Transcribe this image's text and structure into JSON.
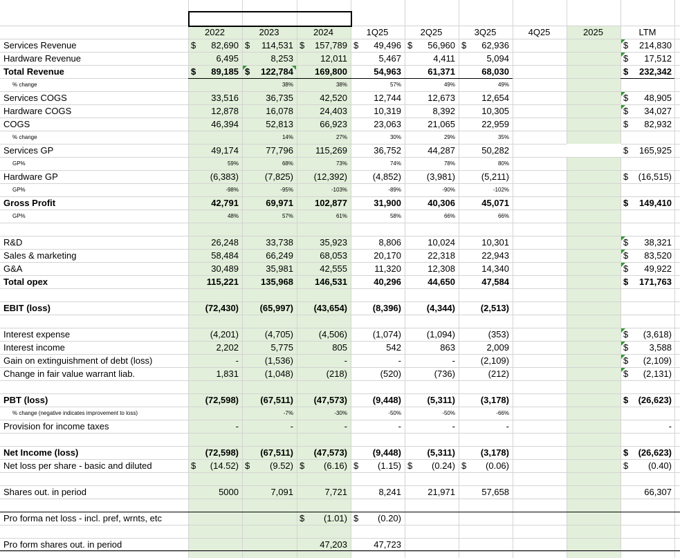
{
  "colors": {
    "green_fill": "#e2efda",
    "grid": "#d4d4d4",
    "flag": "#339933"
  },
  "columns": [
    "2022",
    "2023",
    "2024",
    "1Q25",
    "2Q25",
    "3Q25",
    "4Q25",
    "2025",
    "LTM"
  ],
  "rows": [
    {
      "label": "Services Revenue",
      "values": [
        "$ 82,690",
        "$ 114,531",
        "$ 157,789",
        "$ 49,496",
        "$ 56,960",
        "$ 62,936",
        "",
        "",
        "$ 214,830"
      ]
    },
    {
      "label": "Hardware Revenue",
      "values": [
        "6,495",
        "8,253",
        "12,011",
        "5,467",
        "4,411",
        "5,094",
        "",
        "",
        "$ 17,512"
      ]
    },
    {
      "label": "Total Revenue",
      "values": [
        "$ 89,185",
        "$ 122,784",
        "169,800",
        "54,963",
        "61,371",
        "68,030",
        "",
        "",
        "$ 232,342"
      ]
    },
    {
      "label": "% change",
      "values": [
        "",
        "38%",
        "38%",
        "57%",
        "49%",
        "49%",
        "",
        "",
        ""
      ]
    },
    {
      "label": "Services COGS",
      "values": [
        "33,516",
        "36,735",
        "42,520",
        "12,744",
        "12,673",
        "12,654",
        "",
        "",
        "$ 48,905"
      ]
    },
    {
      "label": "Hardware COGS",
      "values": [
        "12,878",
        "16,078",
        "24,403",
        "10,319",
        "8,392",
        "10,305",
        "",
        "",
        "$ 34,027"
      ]
    },
    {
      "label": "COGS",
      "values": [
        "46,394",
        "52,813",
        "66,923",
        "23,063",
        "21,065",
        "22,959",
        "",
        "",
        "$ 82,932"
      ]
    },
    {
      "label": "% change",
      "values": [
        "",
        "14%",
        "27%",
        "30%",
        "29%",
        "35%",
        "",
        "",
        ""
      ]
    },
    {
      "label": "Services GP",
      "values": [
        "49,174",
        "77,796",
        "115,269",
        "36,752",
        "44,287",
        "50,282",
        "",
        "",
        "$ 165,925"
      ]
    },
    {
      "label": "GP%",
      "values": [
        "59%",
        "68%",
        "73%",
        "74%",
        "78%",
        "80%",
        "",
        "",
        ""
      ]
    },
    {
      "label": "Hardware GP",
      "values": [
        "(6,383)",
        "(7,825)",
        "(12,392)",
        "(4,852)",
        "(3,981)",
        "(5,211)",
        "",
        "",
        "$ (16,515)"
      ]
    },
    {
      "label": "GP%",
      "values": [
        "-98%",
        "-95%",
        "-103%",
        "-89%",
        "-90%",
        "-102%",
        "",
        "",
        ""
      ]
    },
    {
      "label": "Gross Profit",
      "values": [
        "42,791",
        "69,971",
        "102,877",
        "31,900",
        "40,306",
        "45,071",
        "",
        "",
        "$ 149,410"
      ]
    },
    {
      "label": "GP%",
      "values": [
        "48%",
        "57%",
        "61%",
        "58%",
        "66%",
        "66%",
        "",
        "",
        ""
      ]
    },
    {
      "label": "",
      "values": [
        "",
        "",
        "",
        "",
        "",
        "",
        "",
        "",
        ""
      ]
    },
    {
      "label": "R&D",
      "values": [
        "26,248",
        "33,738",
        "35,923",
        "8,806",
        "10,024",
        "10,301",
        "",
        "",
        "$ 38,321"
      ]
    },
    {
      "label": "Sales & marketing",
      "values": [
        "58,484",
        "66,249",
        "68,053",
        "20,170",
        "22,318",
        "22,943",
        "",
        "",
        "$ 83,520"
      ]
    },
    {
      "label": "G&A",
      "values": [
        "30,489",
        "35,981",
        "42,555",
        "11,320",
        "12,308",
        "14,340",
        "",
        "",
        "$ 49,922"
      ]
    },
    {
      "label": "Total opex",
      "values": [
        "115,221",
        "135,968",
        "146,531",
        "40,296",
        "44,650",
        "47,584",
        "",
        "",
        "$ 171,763"
      ]
    },
    {
      "label": "",
      "values": [
        "",
        "",
        "",
        "",
        "",
        "",
        "",
        "",
        ""
      ]
    },
    {
      "label": "EBIT (loss)",
      "values": [
        "(72,430)",
        "(65,997)",
        "(43,654)",
        "(8,396)",
        "(4,344)",
        "(2,513)",
        "",
        "",
        ""
      ]
    },
    {
      "label": "",
      "values": [
        "",
        "",
        "",
        "",
        "",
        "",
        "",
        "",
        ""
      ]
    },
    {
      "label": "Interest expense",
      "values": [
        "(4,201)",
        "(4,705)",
        "(4,506)",
        "(1,074)",
        "(1,094)",
        "(353)",
        "",
        "",
        "$ (3,618)"
      ]
    },
    {
      "label": "Interest income",
      "values": [
        "2,202",
        "5,775",
        "805",
        "542",
        "863",
        "2,009",
        "",
        "",
        "$ 3,588"
      ]
    },
    {
      "label": "Gain on extinguishment of debt (loss)",
      "values": [
        "-",
        "(1,536)",
        "-",
        "-",
        "-",
        "(2,109)",
        "",
        "",
        "$ (2,109)"
      ]
    },
    {
      "label": "Change in fair value warrant liab.",
      "values": [
        "1,831",
        "(1,048)",
        "(218)",
        "(520)",
        "(736)",
        "(212)",
        "",
        "",
        "$ (2,131)"
      ]
    },
    {
      "label": "",
      "values": [
        "",
        "",
        "",
        "",
        "",
        "",
        "",
        "",
        ""
      ]
    },
    {
      "label": "PBT (loss)",
      "values": [
        "(72,598)",
        "(67,511)",
        "(47,573)",
        "(9,448)",
        "(5,311)",
        "(3,178)",
        "",
        "",
        "$ (26,623)"
      ]
    },
    {
      "label": "% change (negative indicates improvement to loss)",
      "values": [
        "",
        "-7%",
        "-30%",
        "-50%",
        "-50%",
        "-66%",
        "",
        "",
        ""
      ]
    },
    {
      "label": "Provision for income taxes",
      "values": [
        "-",
        "-",
        "-",
        "-",
        "-",
        "-",
        "",
        "",
        "-"
      ]
    },
    {
      "label": "",
      "values": [
        "",
        "",
        "",
        "",
        "",
        "",
        "",
        "",
        ""
      ]
    },
    {
      "label": "Net Income (loss)",
      "values": [
        "(72,598)",
        "(67,511)",
        "(47,573)",
        "(9,448)",
        "(5,311)",
        "(3,178)",
        "",
        "",
        "$ (26,623)"
      ]
    },
    {
      "label": "Net loss per share - basic and diluted",
      "values": [
        "$ (14.52)",
        "$ (9.52)",
        "$ (6.16)",
        "$ (1.15)",
        "$ (0.24)",
        "$ (0.06)",
        "",
        "",
        "$ (0.40)"
      ]
    },
    {
      "label": "",
      "values": [
        "",
        "",
        "",
        "",
        "",
        "",
        "",
        "",
        ""
      ]
    },
    {
      "label": "Shares out. in period",
      "values": [
        "5000",
        "7,091",
        "7,721",
        "8,241",
        "21,971",
        "57,658",
        "",
        "",
        "66,307"
      ]
    },
    {
      "label": "",
      "values": [
        "",
        "",
        "",
        "",
        "",
        "",
        "",
        "",
        ""
      ]
    },
    {
      "label": "Pro forma net loss - incl. pref, wrnts, etc",
      "values": [
        "",
        "",
        "$ (1.01)",
        "$ (0.20)",
        "",
        "",
        "",
        "",
        ""
      ]
    },
    {
      "label": "",
      "values": [
        "",
        "",
        "",
        "",
        "",
        "",
        "",
        "",
        ""
      ]
    },
    {
      "label": "Pro form shares out. in period",
      "values": [
        "",
        "",
        "47,203",
        "47,723",
        "",
        "",
        "",
        "",
        ""
      ]
    }
  ]
}
